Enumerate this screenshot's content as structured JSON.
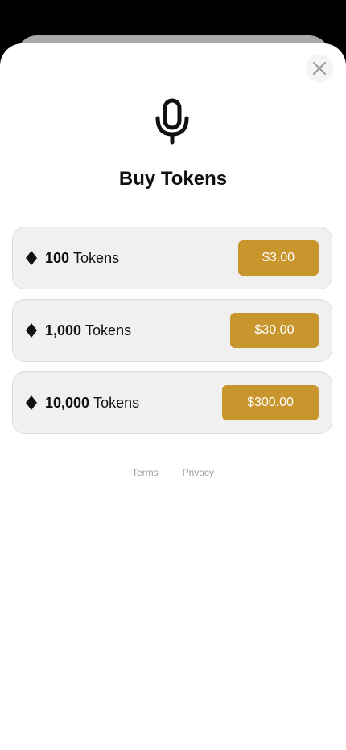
{
  "header": {
    "close_icon": "close-icon",
    "hero_icon": "microphone-icon",
    "title": "Buy Tokens"
  },
  "packages": [
    {
      "amount": "100",
      "unit": "Tokens",
      "price": "$3.00"
    },
    {
      "amount": "1,000",
      "unit": "Tokens",
      "price": "$30.00"
    },
    {
      "amount": "10,000",
      "unit": "Tokens",
      "price": "$300.00"
    }
  ],
  "footer": {
    "terms": "Terms",
    "privacy": "Privacy"
  },
  "colors": {
    "accent": "#c9962e",
    "card_bg": "#f0f0f0",
    "backdrop": "#000000"
  }
}
